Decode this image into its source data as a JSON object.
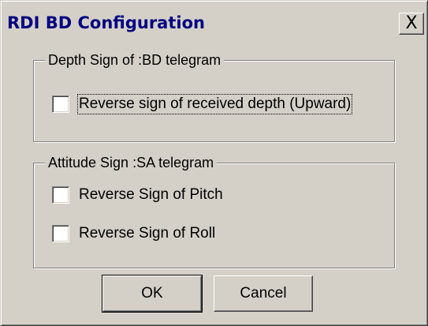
{
  "window": {
    "title": "RDI BD Configuration",
    "close_symbol": "X",
    "close_icon": "close-icon"
  },
  "depth_group": {
    "legend": "Depth Sign of :BD telegram",
    "reverse_depth_label": "Reverse sign of received depth (Upward)",
    "reverse_depth_checked": false
  },
  "attitude_group": {
    "legend": "Attitude Sign  :SA telegram",
    "reverse_pitch_label": "Reverse Sign of Pitch",
    "reverse_pitch_checked": false,
    "reverse_roll_label": "Reverse Sign of Roll",
    "reverse_roll_checked": false
  },
  "buttons": {
    "ok_label": "OK",
    "cancel_label": "Cancel"
  },
  "colors": {
    "face": "#d4d0c8",
    "title_text": "#000080"
  }
}
